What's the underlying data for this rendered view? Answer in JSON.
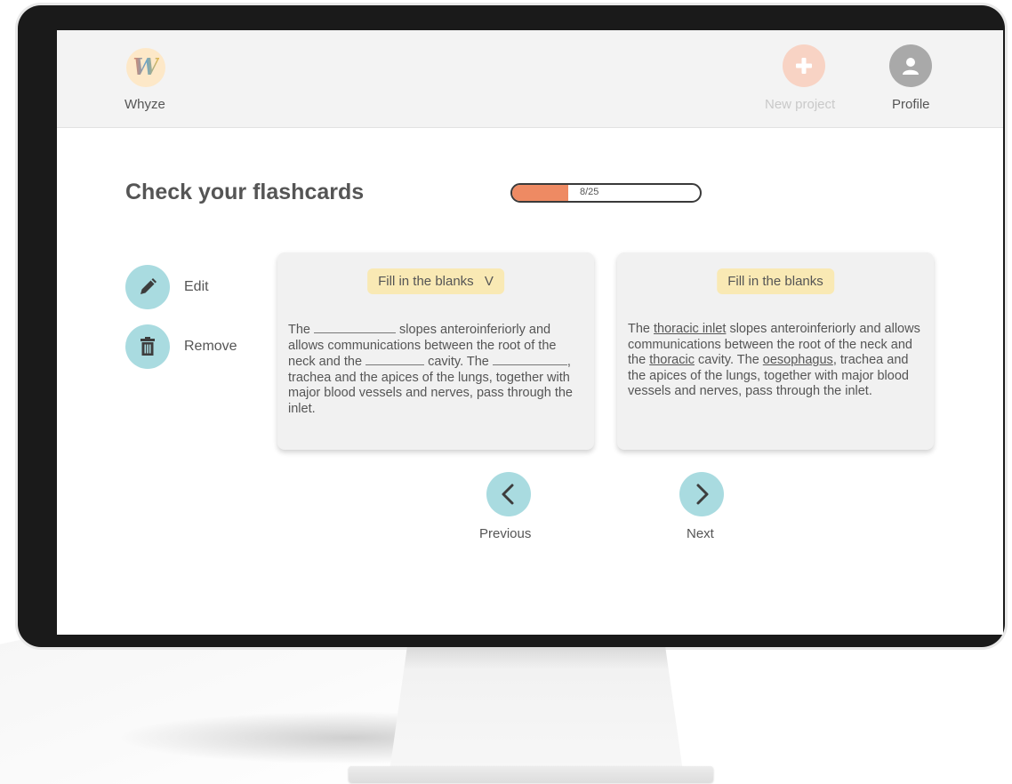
{
  "app": {
    "name": "Whyze",
    "logo_letter": "W"
  },
  "header": {
    "new_project_label": "New project",
    "profile_label": "Profile",
    "new_project_icon": "plus-icon",
    "profile_icon": "user-icon"
  },
  "page": {
    "title": "Check your flashcards",
    "progress": {
      "current": 8,
      "total": 25,
      "text": "8/25",
      "fraction": 0.3
    }
  },
  "actions": [
    {
      "label": "Edit",
      "icon": "pencil-icon"
    },
    {
      "label": "Remove",
      "icon": "trash-icon"
    }
  ],
  "cards": {
    "question": {
      "type_label": "Fill in the blanks",
      "dropdown_glyph": "V",
      "segments": [
        "The ",
        " slopes anteroinferiorly and allows communications between the root of the neck and the ",
        " cavity. The ",
        ", trachea and the apices of the lungs, together with major blood vessels and nerves, pass through the inlet."
      ]
    },
    "answer": {
      "type_label": "Fill in the blanks",
      "segments": [
        "The ",
        "thoracic inlet",
        " slopes anteroinferiorly and allows communications between the root of the neck and the ",
        "thoracic",
        " cavity. The ",
        "oesophagus",
        ", trachea and the apices of the lungs, together with major blood vessels and nerves, pass through the inlet."
      ]
    }
  },
  "navigation": {
    "previous_label": "Previous",
    "next_label": "Next",
    "previous_icon": "chevron-left-icon",
    "next_icon": "chevron-right-icon"
  },
  "colors": {
    "accent_orange": "#ee8a63",
    "accent_teal": "#a9dbe0",
    "tag_yellow": "#f9e9b4"
  }
}
